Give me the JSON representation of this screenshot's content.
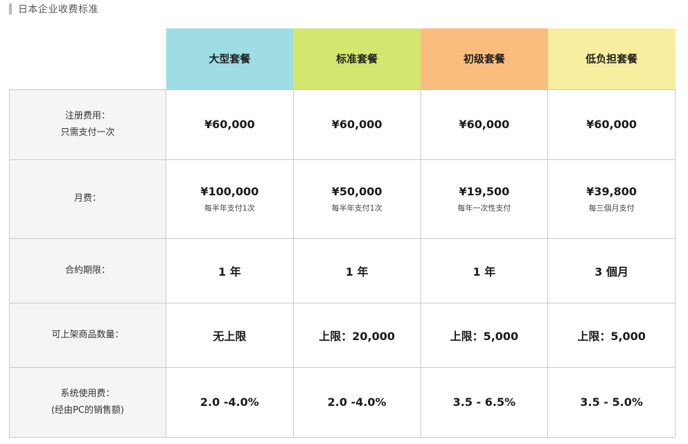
{
  "title": "日本企业收费标准",
  "plans": [
    {
      "name": "大型套餐",
      "color": "#9edde3"
    },
    {
      "name": "标准套餐",
      "color": "#d3e76f"
    },
    {
      "name": "初级套餐",
      "color": "#fbbd7d"
    },
    {
      "name": "低负担套餐",
      "color": "#f8ee9f"
    }
  ],
  "rows": [
    {
      "label_lines": [
        "注册费用：",
        "只需支付一次"
      ],
      "values": [
        {
          "main": "¥60,000"
        },
        {
          "main": "¥60,000"
        },
        {
          "main": "¥60,000"
        },
        {
          "main": "¥60,000"
        }
      ]
    },
    {
      "label_lines": [
        "月费："
      ],
      "values": [
        {
          "main": "¥100,000",
          "sub": "每半年支付1次"
        },
        {
          "main": "¥50,000",
          "sub": "每半年支付1次"
        },
        {
          "main": "¥19,500",
          "sub": "每年一次性支付"
        },
        {
          "main": "¥39,800",
          "sub": "每三個月支付"
        }
      ]
    },
    {
      "label_lines": [
        "合約期限："
      ],
      "values": [
        {
          "main": "1 年"
        },
        {
          "main": "1 年"
        },
        {
          "main": "1 年"
        },
        {
          "main": "3 個月"
        }
      ]
    },
    {
      "label_lines": [
        "可上架商品数量："
      ],
      "values": [
        {
          "main": "无上限"
        },
        {
          "main": "上限：20,000"
        },
        {
          "main": "上限：5,000"
        },
        {
          "main": "上限：5,000"
        }
      ]
    },
    {
      "label_lines": [
        "系统使用费：",
        "(经由PC的销售额)"
      ],
      "values": [
        {
          "main": "2.0 -4.0%"
        },
        {
          "main": "2.0 -4.0%"
        },
        {
          "main": "3.5 - 6.5%"
        },
        {
          "main": "3.5 - 5.0%"
        }
      ]
    }
  ]
}
